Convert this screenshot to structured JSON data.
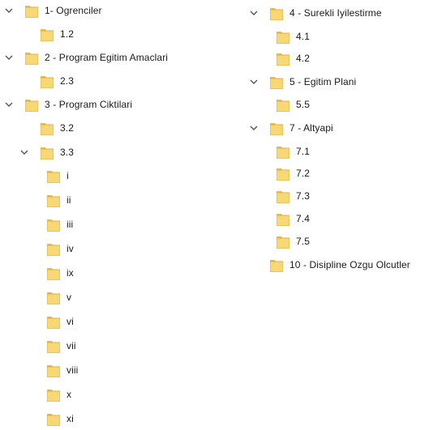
{
  "left_column": [
    {
      "label": "1- Ogrenciler",
      "expanded": true
    },
    {
      "label": "1.2"
    },
    {
      "label": "2 - Program Egitim Amaclari",
      "expanded": true
    },
    {
      "label": "2.3"
    },
    {
      "label": "3 - Program Ciktilari",
      "expanded": true
    },
    {
      "label": "3.2"
    },
    {
      "label": "3.3",
      "expanded": true
    },
    {
      "label": "i"
    },
    {
      "label": "ii"
    },
    {
      "label": "iii"
    },
    {
      "label": "iv"
    },
    {
      "label": "ix"
    },
    {
      "label": "v"
    },
    {
      "label": "vi"
    },
    {
      "label": "vii"
    },
    {
      "label": "viii"
    },
    {
      "label": "x"
    },
    {
      "label": "xi"
    }
  ],
  "right_column": [
    {
      "label": "4 - Surekli Iyilestirme",
      "expanded": true
    },
    {
      "label": "4.1"
    },
    {
      "label": "4.2"
    },
    {
      "label": "5 - Egitim Plani",
      "expanded": true
    },
    {
      "label": "5.5"
    },
    {
      "label": "7 - Altyapi",
      "expanded": true
    },
    {
      "label": "7.1"
    },
    {
      "label": "7.2"
    },
    {
      "label": "7.3"
    },
    {
      "label": "7.4"
    },
    {
      "label": "7.5"
    },
    {
      "label": "10 - Disipline Ozgu Olcutler"
    }
  ],
  "colors": {
    "folder_fill": "#f8d775",
    "folder_tab": "#e9bd4c",
    "folder_edge": "#d9a93a",
    "chevron": "#555555"
  },
  "icons": {
    "folder": "folder-icon",
    "chevron": "chevron-down-icon"
  }
}
